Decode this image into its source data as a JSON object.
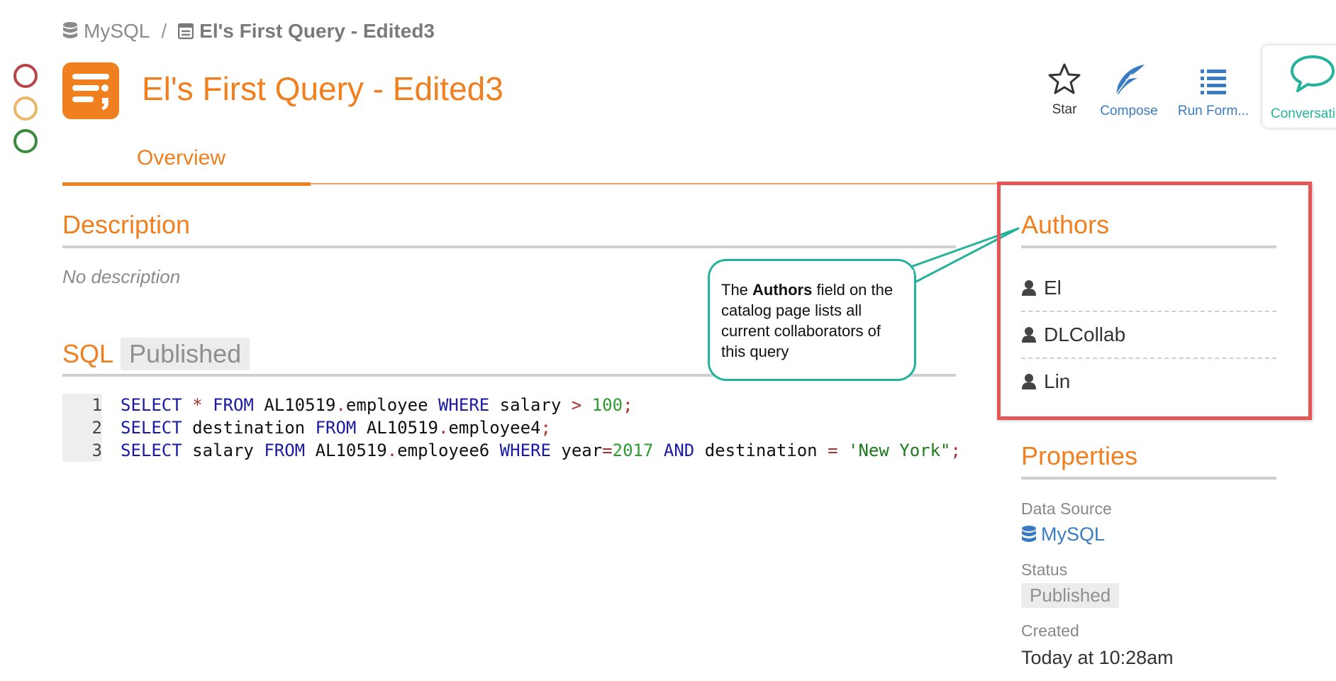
{
  "breadcrumb": {
    "root": "MySQL",
    "separator": "/",
    "current": "El's First Query - Edited3"
  },
  "title": "El's First Query - Edited3",
  "toolbar": {
    "star": "Star",
    "compose": "Compose",
    "run_form": "Run Form...",
    "conversation": "Conversation"
  },
  "tabs": {
    "overview": "Overview"
  },
  "description": {
    "title": "Description",
    "text": "No description"
  },
  "sql": {
    "title": "SQL",
    "status": "Published",
    "line_numbers": [
      "1",
      "2",
      "3"
    ],
    "lines": [
      "SELECT * FROM AL10519.employee WHERE salary > 100;",
      "SELECT destination FROM AL10519.employee4;",
      "SELECT salary FROM AL10519.employee6 WHERE year=2017 AND destination = 'New York\";"
    ]
  },
  "callout": {
    "prefix": "The ",
    "bold": "Authors",
    "suffix": " field on the catalog page lists all current collaborators of this query"
  },
  "authors": {
    "title": "Authors",
    "items": [
      "El",
      "DLCollab",
      "Lin"
    ]
  },
  "properties": {
    "title": "Properties",
    "data_source_label": "Data Source",
    "data_source_value": "MySQL",
    "status_label": "Status",
    "status_value": "Published",
    "created_label": "Created",
    "created_value": "Today at 10:28am"
  },
  "colors": {
    "accent": "#f07f1f",
    "link": "#3a7cc1",
    "teal": "#24b39a",
    "highlight": "#e65555",
    "dot_red": "#b84448",
    "dot_yellow": "#eab76a",
    "dot_green": "#3b8a3f"
  }
}
